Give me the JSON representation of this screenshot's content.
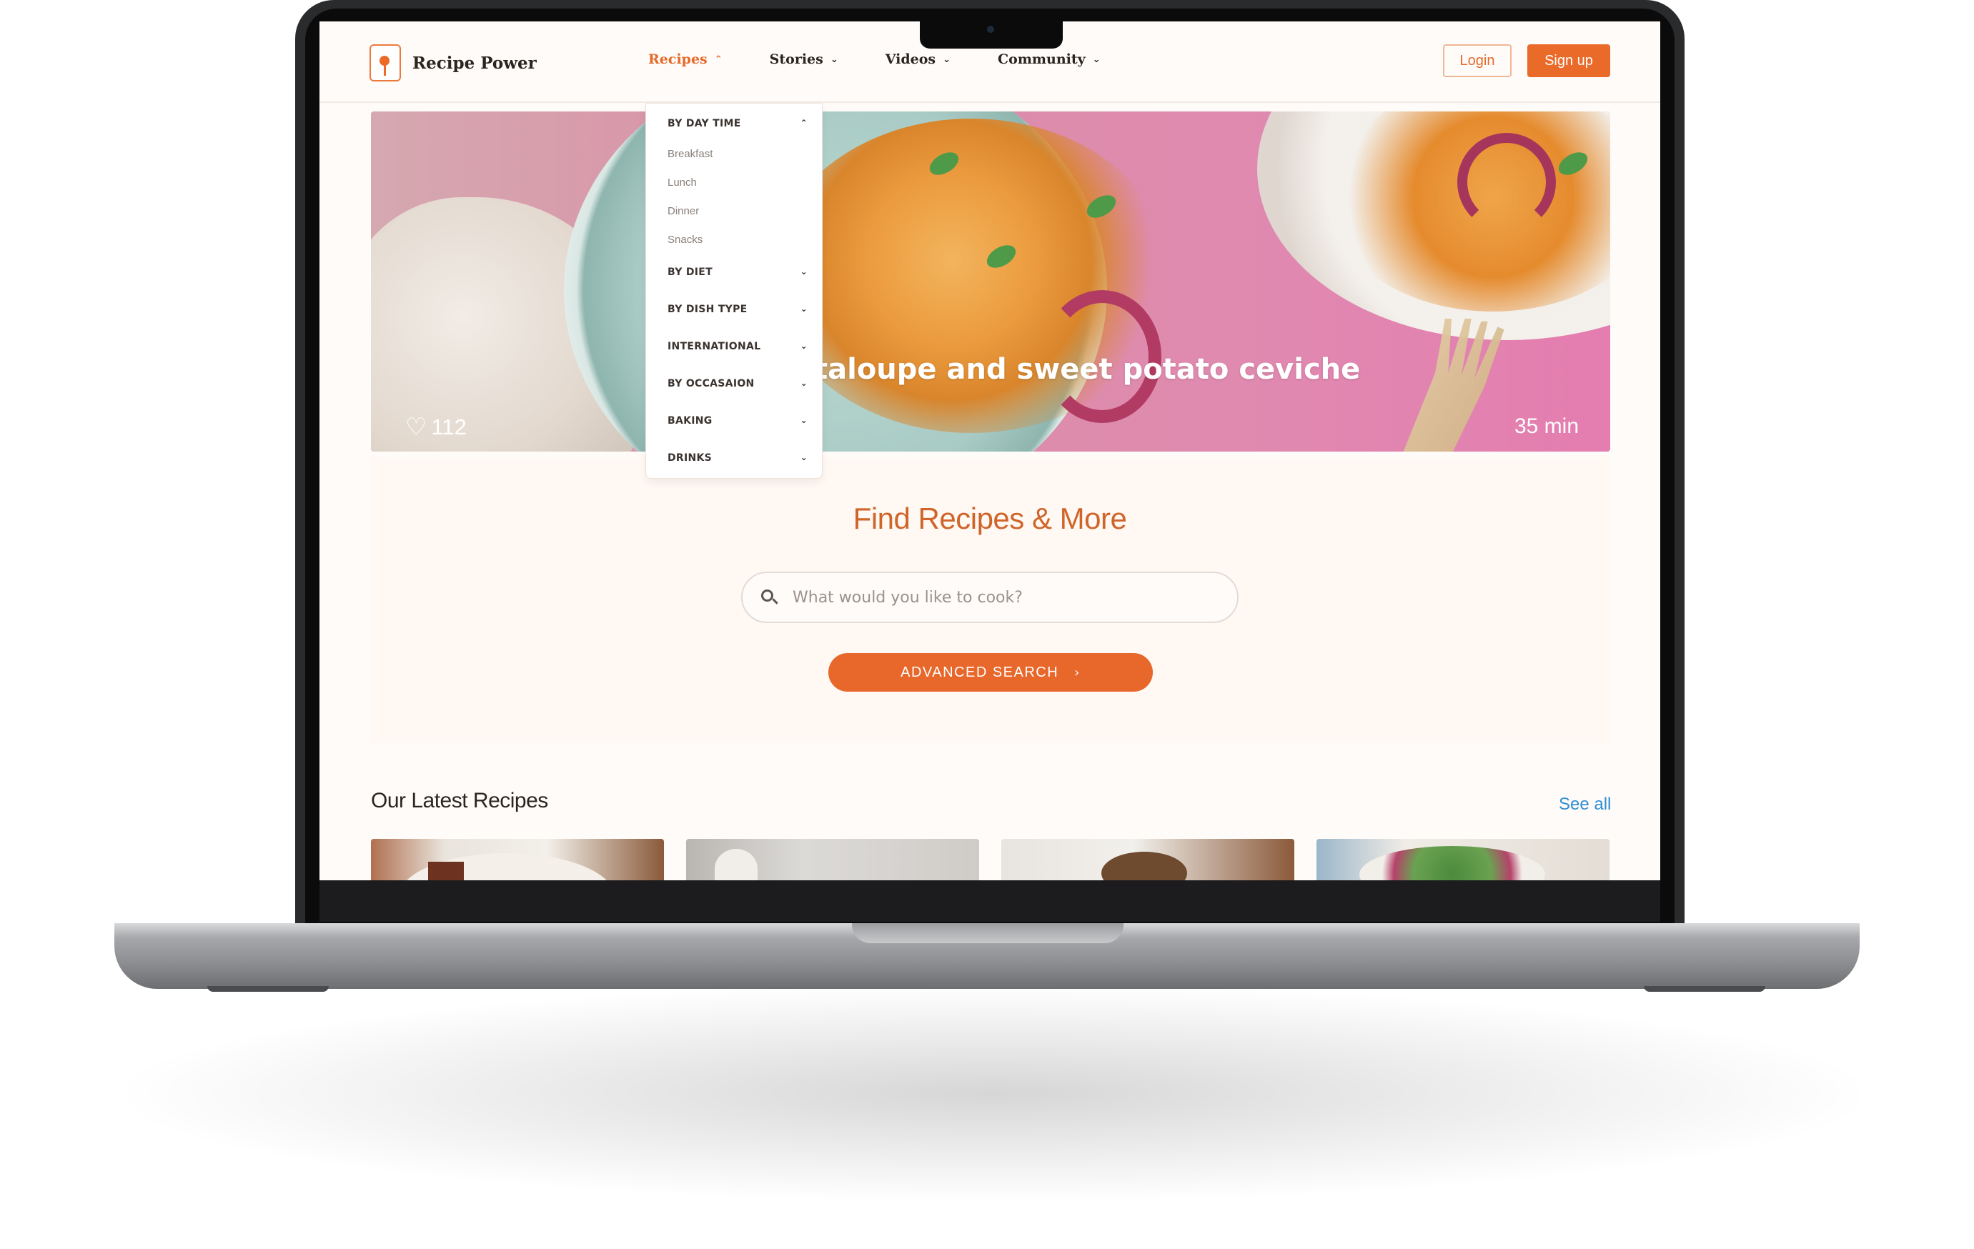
{
  "brand": {
    "name": "Recipe Power"
  },
  "nav": {
    "items": [
      {
        "label": "Recipes",
        "active": true,
        "chevron": "chevron-up-icon"
      },
      {
        "label": "Stories",
        "active": false,
        "chevron": "chevron-down-icon"
      },
      {
        "label": "Videos",
        "active": false,
        "chevron": "chevron-down-icon"
      },
      {
        "label": "Community",
        "active": false,
        "chevron": "chevron-down-icon"
      }
    ],
    "login_label": "Login",
    "signup_label": "Sign up"
  },
  "dropdown": {
    "sections": [
      {
        "label": "BY DAY TIME",
        "expanded": true,
        "items": [
          "Breakfast",
          "Lunch",
          "Dinner",
          "Snacks"
        ]
      },
      {
        "label": "BY DIET",
        "expanded": false
      },
      {
        "label": "BY DISH TYPE",
        "expanded": false
      },
      {
        "label": "INTERNATIONAL",
        "expanded": false
      },
      {
        "label": "BY OCCASAION",
        "expanded": false
      },
      {
        "label": "BAKING",
        "expanded": false
      },
      {
        "label": "DRINKS",
        "expanded": false
      }
    ]
  },
  "hero": {
    "title": "taloupe and sweet potato ceviche",
    "likes": "112",
    "time": "35 min"
  },
  "search": {
    "title": "Find Recipes & More",
    "placeholder": "What would you like to cook?",
    "advanced_label": "ADVANCED SEARCH"
  },
  "latest": {
    "title": "Our Latest Recipes",
    "see_all": "See all"
  },
  "colors": {
    "accent": "#e8672a",
    "page_bg": "#fffbf8",
    "link": "#2f8ed3"
  }
}
